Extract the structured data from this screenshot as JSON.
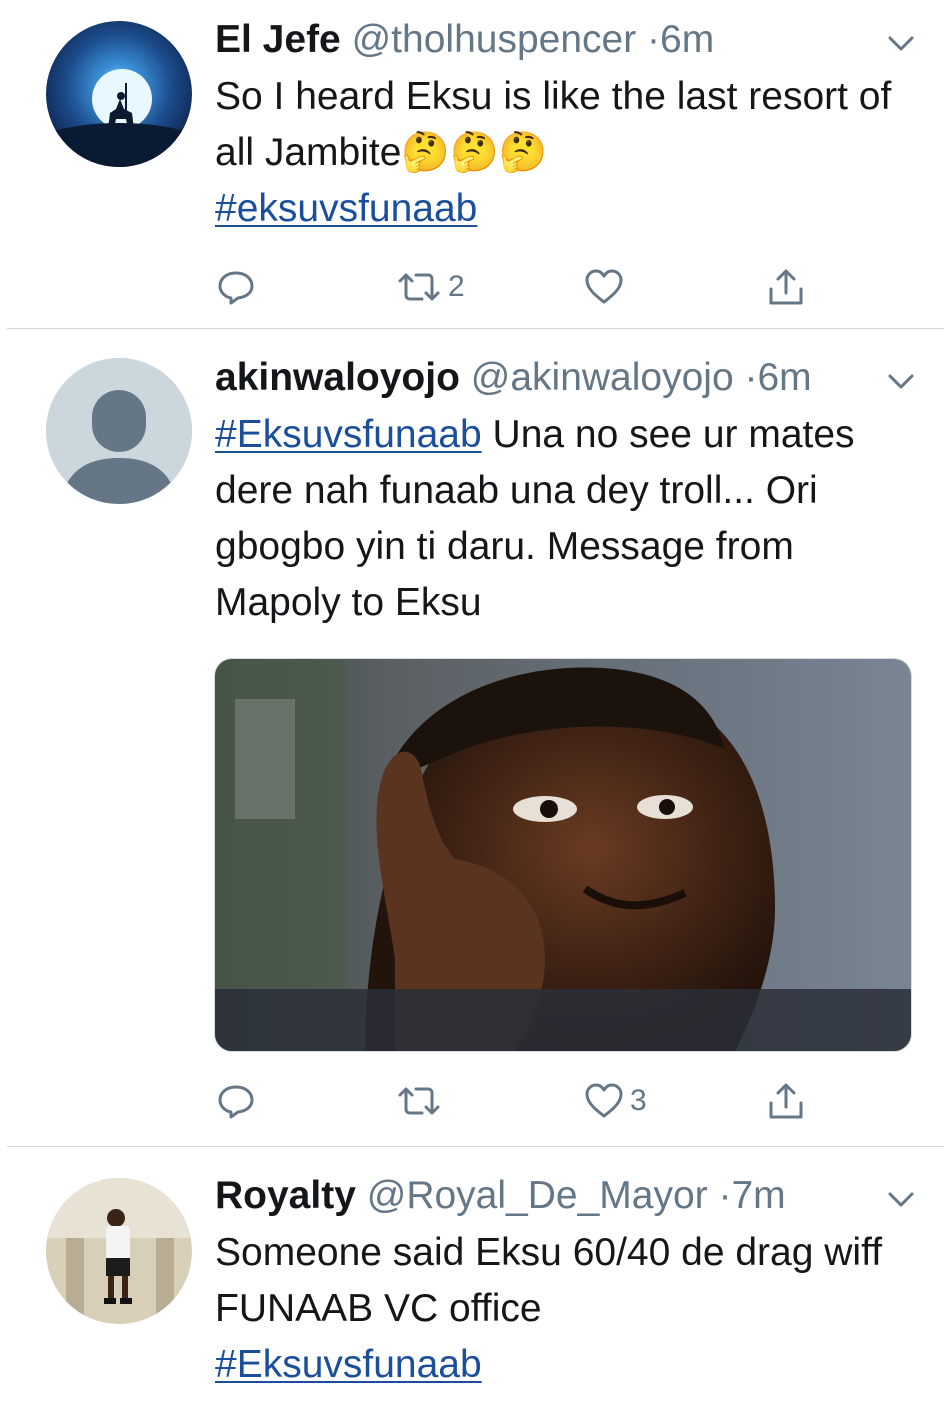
{
  "tweets": [
    {
      "name": "El Jefe",
      "handle": "@tholhuspencer",
      "sep": "·",
      "time": "6m",
      "text_before": "So I heard Eksu is like the last resort of all Jambite",
      "emoji": "🤔🤔🤔",
      "hashtag": "#eksuvsfunaab",
      "reply_count": "",
      "retweet_count": "2",
      "like_count": "",
      "avatar_icon": "knight-silhouette-moon"
    },
    {
      "name": "akinwaloyojo",
      "handle": "@akinwaloyojo",
      "sep": "·",
      "time": "6m",
      "hashtag": "#Eksuvsfunaab",
      "text_after": " Una no see ur mates dere nah funaab una dey troll... Ori gbogbo yin ti daru. Message from Mapoly to Eksu",
      "reply_count": "",
      "retweet_count": "",
      "like_count": "3",
      "avatar_icon": "default-profile-icon",
      "media_icon": "meme-photo"
    },
    {
      "name": "Royalty",
      "handle": "@Royal_De_Mayor",
      "sep": "·",
      "time": "7m",
      "text_before": "Someone said Eksu 60/40 de drag wiff FUNAAB VC office",
      "hashtag": "#Eksuvsfunaab",
      "avatar_icon": "user-photo"
    }
  ],
  "colors": {
    "text": "#14171a",
    "secondary": "#657786",
    "hashtag": "#1b4f9c",
    "divider": "#ccd6dd"
  }
}
